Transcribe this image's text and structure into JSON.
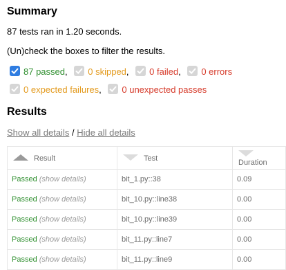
{
  "summary": {
    "heading": "Summary",
    "tests_ran": "87 tests ran in 1.20 seconds.",
    "filter_hint": "(Un)check the boxes to filter the results.",
    "filters": [
      {
        "label": "87 passed",
        "checked": true,
        "color": "#2f8f2f"
      },
      {
        "label": "0 skipped",
        "checked": false,
        "color": "#e39a1d"
      },
      {
        "label": "0 failed",
        "checked": false,
        "color": "#d63a2a"
      },
      {
        "label": "0 errors",
        "checked": false,
        "color": "#d63a2a"
      },
      {
        "label": "0 expected failures",
        "checked": false,
        "color": "#e39a1d"
      },
      {
        "label": "0 unexpected passes",
        "checked": false,
        "color": "#d63a2a"
      }
    ],
    "separator": ","
  },
  "results": {
    "heading": "Results",
    "show_all": "Show all details",
    "slash": "/",
    "hide_all": "Hide all details",
    "columns": {
      "result": "Result",
      "test": "Test",
      "duration": "Duration"
    },
    "rows": [
      {
        "result": "Passed",
        "details": "(show details)",
        "test": "bit_1.py::38",
        "duration": "0.09"
      },
      {
        "result": "Passed",
        "details": "(show details)",
        "test": "bit_10.py::line38",
        "duration": "0.00"
      },
      {
        "result": "Passed",
        "details": "(show details)",
        "test": "bit_10.py::line39",
        "duration": "0.00"
      },
      {
        "result": "Passed",
        "details": "(show details)",
        "test": "bit_11.py::line7",
        "duration": "0.00"
      },
      {
        "result": "Passed",
        "details": "(show details)",
        "test": "bit_11.py::line9",
        "duration": "0.00"
      }
    ]
  }
}
